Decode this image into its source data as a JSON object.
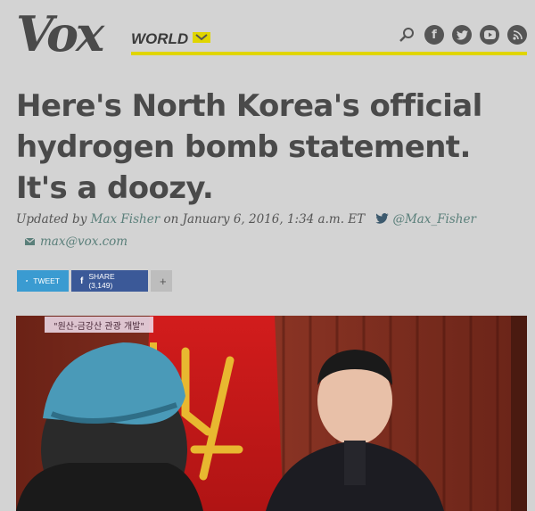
{
  "header": {
    "logo_text": "Vox",
    "section_label": "WORLD",
    "icons": [
      "search-icon",
      "facebook-icon",
      "twitter-icon",
      "youtube-icon",
      "rss-icon"
    ]
  },
  "article": {
    "headline_lines": [
      "Here's North Korea's official",
      "hydrogen bomb statement.",
      "It's a doozy."
    ],
    "byline_prefix": "Updated by",
    "author": "Max Fisher",
    "date_text": "on January 6, 2016, 1:34 a.m. ET",
    "twitter_handle": "@Max_Fisher",
    "email": "max@vox.com"
  },
  "share": {
    "tweet_label": "TWEET",
    "facebook_label": "SHARE (3,149)",
    "more_label": "+"
  },
  "photo": {
    "caption": "\"원산-금강산 관광 개발\""
  },
  "colors": {
    "background": "#d3d3d3",
    "accent_yellow": "#e0d500",
    "link_teal": "#5a7f7a",
    "tweet_blue": "#3a9bd1",
    "facebook_blue": "#3b5998"
  }
}
